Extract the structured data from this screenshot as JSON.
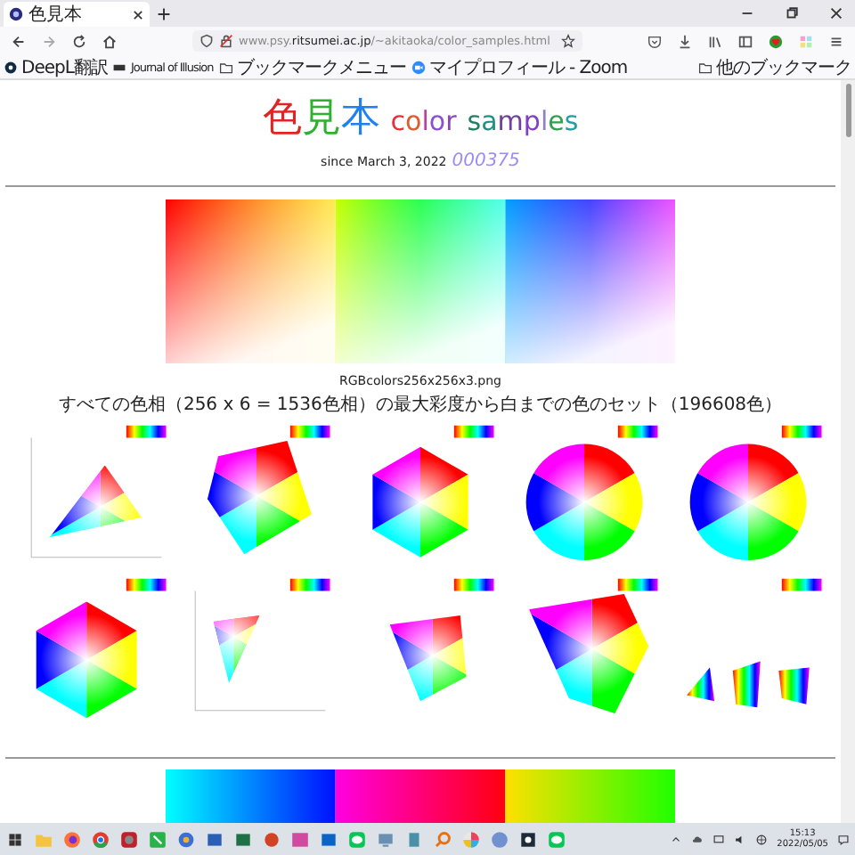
{
  "browser": {
    "tab_title": "色見本",
    "url": "www.psy.**ritsumei.ac.jp**/~akitaoka/color_samples.html",
    "bookmarks": [
      {
        "label": "DeepL翻訳"
      },
      {
        "label": "Journal of Illusion"
      },
      {
        "label": "ブックマークメニュー"
      },
      {
        "label": "マイプロフィール - Zoom"
      }
    ],
    "other_bookmarks": "他のブックマーク"
  },
  "page": {
    "title_kanji": [
      {
        "text": "色",
        "color": "#e02424"
      },
      {
        "text": "見",
        "color": "#30b030"
      },
      {
        "text": "本",
        "color": "#2080f0"
      }
    ],
    "title_words": [
      {
        "letters": [
          {
            "text": "c",
            "color": "#e8303a"
          },
          {
            "text": "o",
            "color": "#e05a30"
          },
          {
            "text": "l",
            "color": "#c040a0"
          },
          {
            "text": "o",
            "color": "#8c50d0"
          },
          {
            "text": "r",
            "color": "#9040c0"
          }
        ]
      },
      {
        "letters": [
          {
            "text": "s",
            "color": "#208060"
          },
          {
            "text": "a",
            "color": "#209080"
          },
          {
            "text": "m",
            "color": "#7040a0"
          },
          {
            "text": "p",
            "color": "#8040c0"
          },
          {
            "text": "l",
            "color": "#9080c0"
          },
          {
            "text": "e",
            "color": "#30a050"
          },
          {
            "text": "s",
            "color": "#20a0a0"
          }
        ]
      }
    ],
    "since": "since March 3, 2022",
    "counter": "000375",
    "caption": "RGBcolors256x256x3.png",
    "description": "すべての色相（256 x 6 = 1536色相）の最大彩度から白までの色のセット（196608色）"
  },
  "taskbar": {
    "time": "15:13",
    "date": "2022/05/05"
  }
}
